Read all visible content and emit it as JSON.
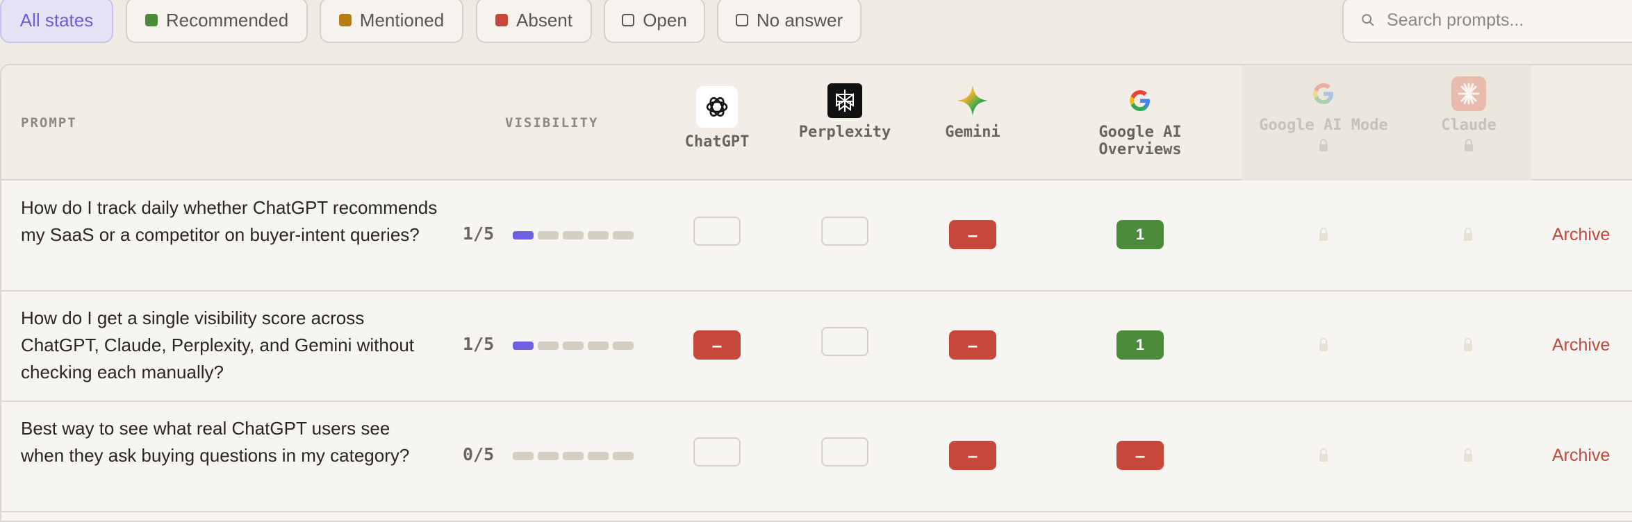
{
  "filters": {
    "all": "All states",
    "recommended": "Recommended",
    "mentioned": "Mentioned",
    "absent": "Absent",
    "open": "Open",
    "no_answer": "No answer"
  },
  "search": {
    "placeholder": "Search prompts..."
  },
  "header": {
    "prompt": "PROMPT",
    "visibility": "VISIBILITY",
    "services": [
      "ChatGPT",
      "Perplexity",
      "Gemini",
      "Google AI Overviews",
      "Google AI Mode",
      "Claude"
    ]
  },
  "colors": {
    "recommended": "#4b8b39",
    "mentioned": "#b97d16",
    "absent": "#c8473b",
    "accent": "#6e5fe3"
  },
  "rows": [
    {
      "prompt": "How do I track daily whether ChatGPT recommends my SaaS or a competitor on buyer-intent queries?",
      "score": "1/5",
      "visibility_filled": 1,
      "cells": [
        "empty",
        "empty",
        "–",
        "1"
      ],
      "action": "Archive"
    },
    {
      "prompt": "How do I get a single visibility score across ChatGPT, Claude, Perplexity, and Gemini without checking each manually?",
      "score": "1/5",
      "visibility_filled": 1,
      "cells": [
        "–",
        "empty",
        "–",
        "1"
      ],
      "action": "Archive"
    },
    {
      "prompt": "Best way to see what real ChatGPT users see when they ask buying questions in my category?",
      "score": "0/5",
      "visibility_filled": 0,
      "cells": [
        "empty",
        "empty",
        "–",
        "–"
      ],
      "action": "Archive"
    }
  ]
}
